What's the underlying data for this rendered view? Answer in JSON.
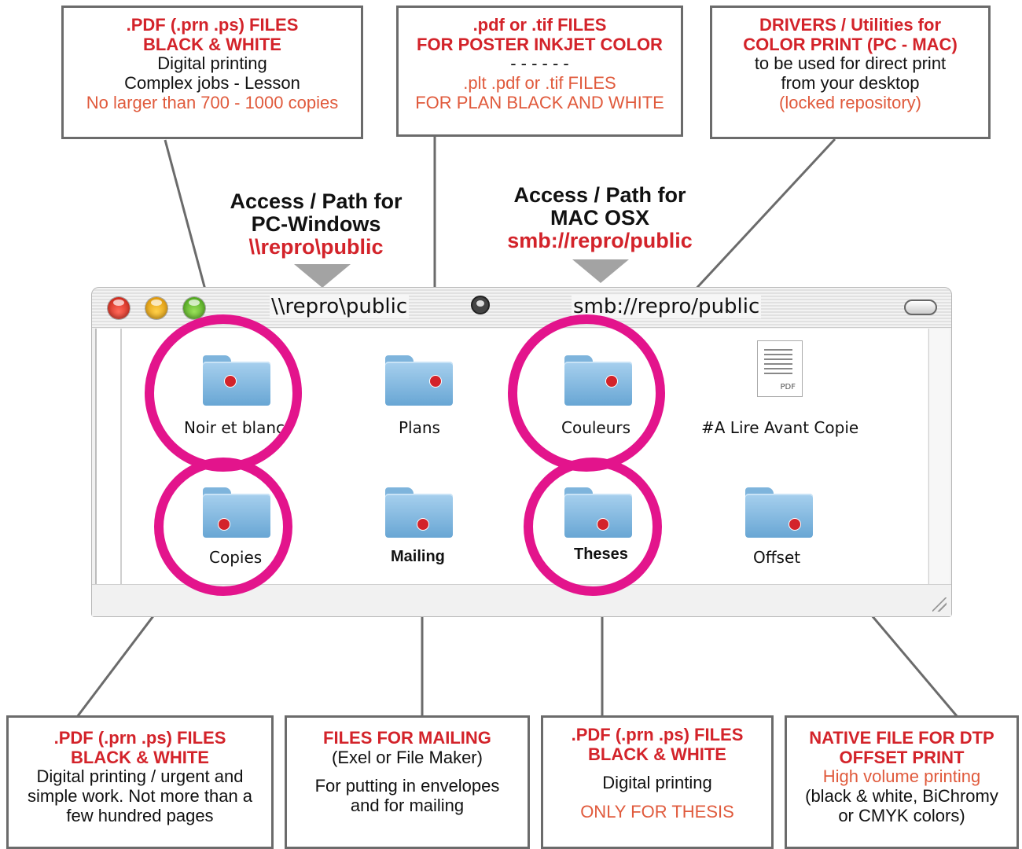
{
  "top_boxes": [
    {
      "lines": [
        ".PDF  (.prn  .ps) FILES",
        "BLACK & WHITE",
        "Digital printing",
        "Complex jobs - Lesson",
        "No larger than 700 - 1000 copies"
      ]
    },
    {
      "lines": [
        ".pdf or .tif FILES",
        "FOR POSTER INKJET COLOR",
        "- - - - - -",
        ".plt  .pdf or  .tif FILES",
        "FOR  PLAN  BLACK  AND  WHITE"
      ]
    },
    {
      "lines": [
        "DRIVERS / Utilities  for",
        "COLOR PRINT (PC - MAC)",
        "to be used for direct print",
        "from your desktop",
        "(locked repository)"
      ]
    }
  ],
  "access": [
    {
      "lines": [
        "Access / Path for",
        "PC-Windows",
        "\\\\repro\\public"
      ]
    },
    {
      "lines": [
        "Access / Path for",
        "MAC OSX",
        "smb://repro/public"
      ]
    }
  ],
  "window": {
    "title_pc": "\\\\repro\\public",
    "title_mac": "smb://repro/public",
    "items": [
      "Noir et blanc",
      "Plans",
      "Couleurs",
      "#A Lire Avant Copie",
      "Copies",
      "Mailing",
      "Theses",
      "Offset"
    ],
    "doc_tag": "PDF"
  },
  "bottom_boxes": [
    {
      "lines": [
        ".PDF  (.prn  .ps) FILES",
        "BLACK & WHITE",
        "Digital printing / urgent and",
        "simple work. Not more than a",
        "few hundred pages"
      ]
    },
    {
      "lines": [
        "FILES FOR MAILING",
        "(Exel or File Maker)",
        "For putting in envelopes",
        "and for mailing"
      ]
    },
    {
      "lines": [
        ".PDF  (.prn  .ps) FILES",
        "BLACK & WHITE",
        "Digital printing",
        "ONLY FOR THESIS"
      ]
    },
    {
      "lines": [
        "NATIVE FILE FOR DTP",
        "OFFSET PRINT",
        "High volume printing",
        "(black & white, BiChromy",
        "or CMYK colors)"
      ]
    }
  ],
  "colors": {
    "highlight_ring": "#e3148c",
    "title_red": "#d3232a",
    "note_red": "#e05a3c",
    "callout_border": "#6b6b6b"
  }
}
